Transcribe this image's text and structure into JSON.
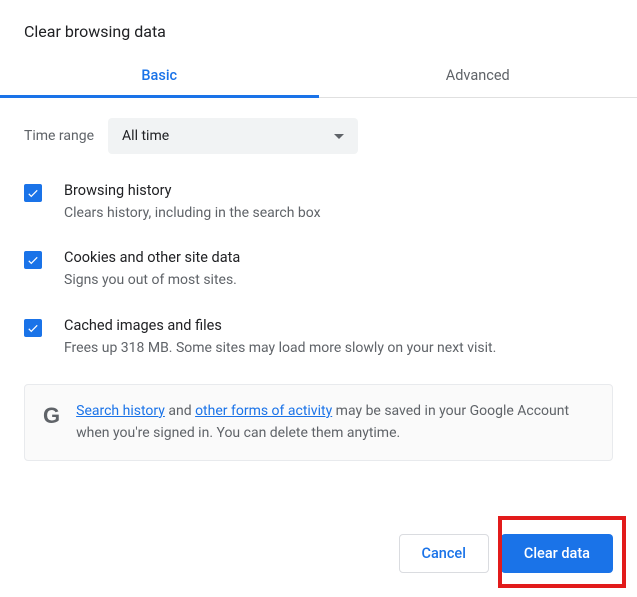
{
  "title": "Clear browsing data",
  "tabs": {
    "basic": "Basic",
    "advanced": "Advanced"
  },
  "timerange": {
    "label": "Time range",
    "value": "All time"
  },
  "options": [
    {
      "title": "Browsing history",
      "desc": "Clears history, including in the search box",
      "checked": true
    },
    {
      "title": "Cookies and other site data",
      "desc": "Signs you out of most sites.",
      "checked": true
    },
    {
      "title": "Cached images and files",
      "desc": "Frees up 318 MB. Some sites may load more slowly on your next visit.",
      "checked": true
    }
  ],
  "info": {
    "link1": "Search history",
    "mid1": " and ",
    "link2": "other forms of activity",
    "rest": " may be saved in your Google Account when you're signed in. You can delete them anytime."
  },
  "buttons": {
    "cancel": "Cancel",
    "clear": "Clear data"
  }
}
